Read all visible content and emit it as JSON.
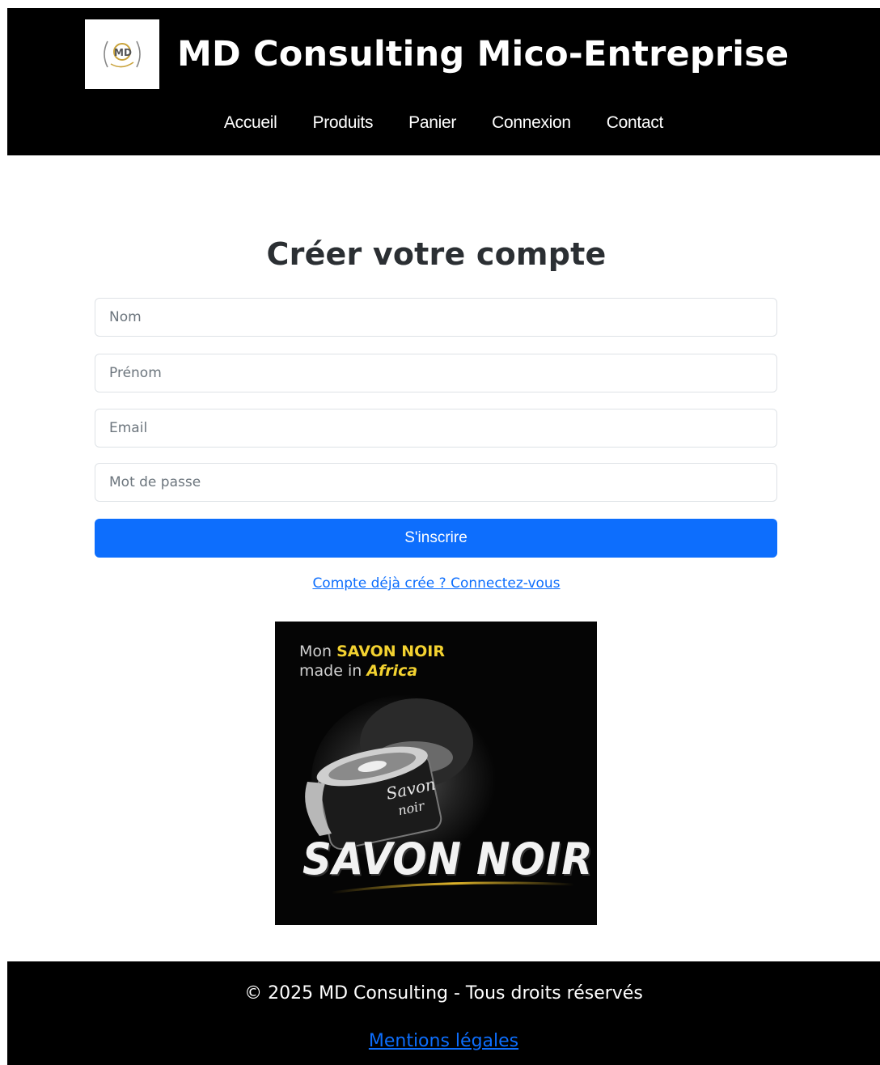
{
  "header": {
    "title": "MD Consulting Mico-Entreprise",
    "logo_text": "MD",
    "nav": [
      {
        "label": "Accueil"
      },
      {
        "label": "Produits"
      },
      {
        "label": "Panier"
      },
      {
        "label": "Connexion"
      },
      {
        "label": "Contact"
      }
    ]
  },
  "main": {
    "title": "Créer votre compte",
    "fields": {
      "nom": {
        "placeholder": "Nom",
        "value": ""
      },
      "prenom": {
        "placeholder": "Prénom",
        "value": ""
      },
      "email": {
        "placeholder": "Email",
        "value": ""
      },
      "password": {
        "placeholder": "Mot de passe",
        "value": ""
      }
    },
    "submit_label": "S'inscrire",
    "login_link": "Compte déjà crée ? Connectez-vous"
  },
  "promo": {
    "line1_prefix": "Mon ",
    "line1_highlight": "SAVON NOIR",
    "line2_prefix": "made in ",
    "line2_highlight": "Africa",
    "product_label_1": "Savon",
    "product_label_2": "noir",
    "big_text": "SAVON NOIR"
  },
  "footer": {
    "copyright": "© 2025 MD Consulting - Tous droits réservés",
    "legal_link": "Mentions légales"
  },
  "colors": {
    "header_bg": "#000000",
    "primary": "#0d6efd",
    "promo_accent": "#f3d230",
    "logo_gold": "#c9a23a"
  }
}
